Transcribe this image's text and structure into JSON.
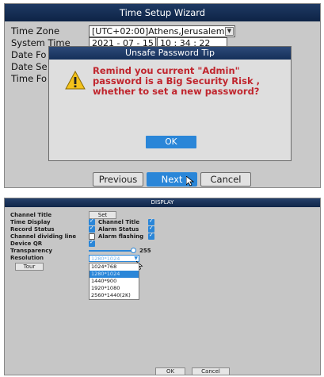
{
  "wizard": {
    "title": "Time Setup Wizard",
    "time_zone_label": "Time Zone",
    "time_zone_value": "[UTC+02:00]Athens,Jerusalem",
    "system_time_label": "System Time",
    "date_value": "2021 - 07 - 15",
    "time_value": "10 : 34 : 22",
    "date_format_label": "Date Fo",
    "date_separator_label": "Date Se",
    "time_format_label": "Time Fo",
    "dialog": {
      "title": "Unsafe Password Tip",
      "message": "Remind you current \"Admin\" password is a Big Security Risk , whether to set a new password?",
      "ok_label": "OK"
    },
    "previous_label": "Previous",
    "next_label": "Next",
    "cancel_label": "Cancel"
  },
  "display": {
    "title": "DISPLAY",
    "channel_title_label": "Channel Title",
    "set_label": "Set",
    "time_display_label": "Time Display",
    "channel_title_check_label": "Channel Title",
    "record_status_label": "Record Status",
    "alarm_status_label": "Alarm Status",
    "channel_dividing_line_label": "Channel dividing line",
    "alarm_flashing_label": "Alarm flashing",
    "device_qr_label": "Device QR",
    "transparency_label": "Transparency",
    "transparency_value": "255",
    "resolution_label": "Resolution",
    "resolution_value": "1280*1024",
    "tour_label": "Tour",
    "resolution_options": [
      "1024*768",
      "1280*1024",
      "1440*900",
      "1920*1080",
      "2560*1440(2K)"
    ],
    "ok_label": "OK",
    "cancel_label": "Cancel"
  },
  "colors": {
    "accent": "#2a86d8",
    "title_bar": "#13305a",
    "warning_text": "#c0252d",
    "panel_bg": "#c9c9c9"
  }
}
